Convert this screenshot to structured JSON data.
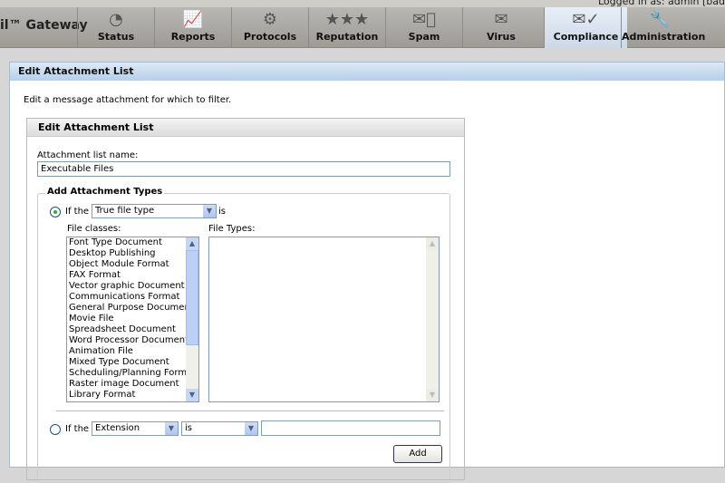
{
  "header": {
    "brand": "il™ Gateway",
    "login_text": "Logged in as: admin [bad",
    "tabs": [
      {
        "label": "Status",
        "icon": "gauge-icon"
      },
      {
        "label": "Reports",
        "icon": "chart-icon"
      },
      {
        "label": "Protocols",
        "icon": "gears-icon"
      },
      {
        "label": "Reputation",
        "icon": "stars-mail-icon"
      },
      {
        "label": "Spam",
        "icon": "mail-blocked-icon"
      },
      {
        "label": "Virus",
        "icon": "mail-shield-icon"
      },
      {
        "label": "Compliance",
        "icon": "mail-check-icon",
        "active": true
      },
      {
        "label": "Administration",
        "icon": "wrench-icon"
      }
    ]
  },
  "panel": {
    "title": "Edit Attachment List",
    "description": "Edit a message attachment for which to filter."
  },
  "form": {
    "box_title": "Edit Attachment List",
    "name_label": "Attachment list name:",
    "name_value": "Executable Files",
    "section_title": "Add Attachment Types",
    "row1": {
      "if_label": "If the",
      "select": "True file type",
      "is_label": "is",
      "selected": true
    },
    "file_classes_label": "File classes:",
    "file_types_label": "File Types:",
    "file_classes": [
      "Font Type Document",
      "Desktop Publishing",
      "Object Module Format",
      "FAX Format",
      "Vector graphic Document",
      "Communications Format",
      "General Purpose Document",
      "Movie File",
      "Spreadsheet Document",
      "Word Processor Document",
      "Animation File",
      "Mixed Type Document",
      "Scheduling/Planning Format",
      "Raster image Document",
      "Library Format"
    ],
    "file_types": [],
    "row2": {
      "if_label": "If the",
      "select": "Extension",
      "op": "is",
      "value": "",
      "selected": false
    },
    "add_label": "Add"
  }
}
